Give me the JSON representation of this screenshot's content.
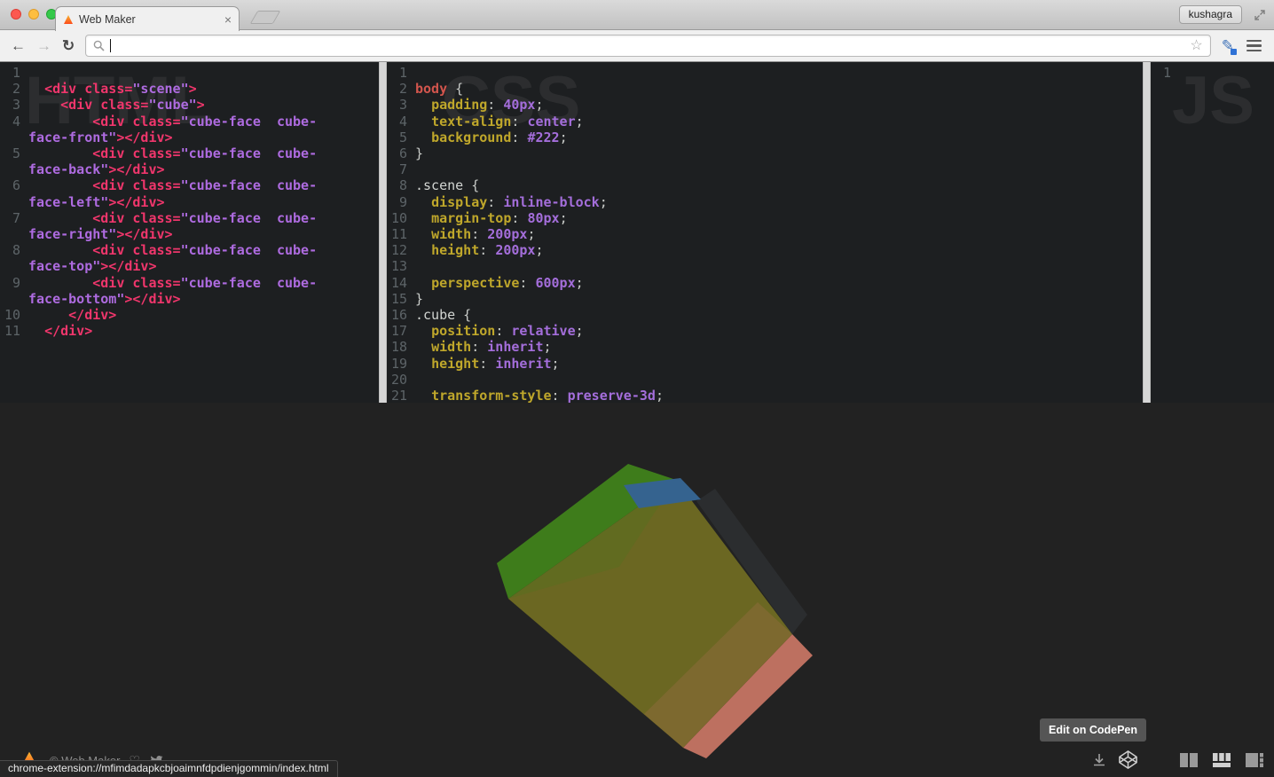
{
  "window": {
    "tab_title": "Web Maker",
    "close_tab": "×",
    "profile_name": "kushagra"
  },
  "toolbar": {
    "back": "←",
    "forward": "→",
    "reload": "↻",
    "url_value": "",
    "bookmark_star": "☆",
    "extension_pencil": "✎"
  },
  "editors": {
    "html": {
      "label": "HTML",
      "lines": [
        {
          "n": 1,
          "s": []
        },
        {
          "n": 2,
          "s": [
            [
              "pln",
              "  "
            ],
            [
              "tag",
              "<div "
            ],
            [
              "attr",
              "class="
            ],
            [
              "str",
              "\"scene\""
            ],
            [
              "tag",
              ">"
            ]
          ]
        },
        {
          "n": 3,
          "s": [
            [
              "pln",
              "    "
            ],
            [
              "tag",
              "<div "
            ],
            [
              "attr",
              "class="
            ],
            [
              "str",
              "\"cube\""
            ],
            [
              "tag",
              ">"
            ]
          ]
        },
        {
          "n": 4,
          "s": [
            [
              "pln",
              "        "
            ],
            [
              "tag",
              "<div "
            ],
            [
              "attr",
              "class="
            ],
            [
              "str",
              "\"cube-face  cube-face-front\""
            ],
            [
              "tag",
              "></div>"
            ]
          ]
        },
        {
          "n": 5,
          "s": [
            [
              "pln",
              "        "
            ],
            [
              "tag",
              "<div "
            ],
            [
              "attr",
              "class="
            ],
            [
              "str",
              "\"cube-face  cube-face-back\""
            ],
            [
              "tag",
              "></div>"
            ]
          ]
        },
        {
          "n": 6,
          "s": [
            [
              "pln",
              "        "
            ],
            [
              "tag",
              "<div "
            ],
            [
              "attr",
              "class="
            ],
            [
              "str",
              "\"cube-face  cube-face-left\""
            ],
            [
              "tag",
              "></div>"
            ]
          ]
        },
        {
          "n": 7,
          "s": [
            [
              "pln",
              "        "
            ],
            [
              "tag",
              "<div "
            ],
            [
              "attr",
              "class="
            ],
            [
              "str",
              "\"cube-face  cube-face-right\""
            ],
            [
              "tag",
              "></div>"
            ]
          ]
        },
        {
          "n": 8,
          "s": [
            [
              "pln",
              "        "
            ],
            [
              "tag",
              "<div "
            ],
            [
              "attr",
              "class="
            ],
            [
              "str",
              "\"cube-face  cube-face-top\""
            ],
            [
              "tag",
              "></div>"
            ]
          ]
        },
        {
          "n": 9,
          "s": [
            [
              "pln",
              "        "
            ],
            [
              "tag",
              "<div "
            ],
            [
              "attr",
              "class="
            ],
            [
              "str",
              "\"cube-face  cube-face-bottom\""
            ],
            [
              "tag",
              "></div>"
            ]
          ]
        },
        {
          "n": 10,
          "s": [
            [
              "pln",
              "     "
            ],
            [
              "tag",
              "</div>"
            ]
          ]
        },
        {
          "n": 11,
          "s": [
            [
              "pln",
              "  "
            ],
            [
              "tag",
              "</div>"
            ]
          ]
        }
      ]
    },
    "css": {
      "label": "CSS",
      "lines": [
        {
          "n": 1,
          "s": []
        },
        {
          "n": 2,
          "s": [
            [
              "ored",
              "body"
            ],
            [
              "pun",
              " {"
            ]
          ]
        },
        {
          "n": 3,
          "s": [
            [
              "pln",
              "  "
            ],
            [
              "prop",
              "padding"
            ],
            [
              "pun",
              ": "
            ],
            [
              "val",
              "40px"
            ],
            [
              "pun",
              ";"
            ]
          ]
        },
        {
          "n": 4,
          "s": [
            [
              "pln",
              "  "
            ],
            [
              "prop",
              "text-align"
            ],
            [
              "pun",
              ": "
            ],
            [
              "val",
              "center"
            ],
            [
              "pun",
              ";"
            ]
          ]
        },
        {
          "n": 5,
          "s": [
            [
              "pln",
              "  "
            ],
            [
              "prop",
              "background"
            ],
            [
              "pun",
              ": "
            ],
            [
              "val",
              "#222"
            ],
            [
              "pun",
              ";"
            ]
          ]
        },
        {
          "n": 6,
          "s": [
            [
              "pun",
              "}"
            ]
          ]
        },
        {
          "n": 7,
          "s": []
        },
        {
          "n": 8,
          "s": [
            [
              "csel",
              ".scene"
            ],
            [
              "pun",
              " {"
            ]
          ]
        },
        {
          "n": 9,
          "s": [
            [
              "pln",
              "  "
            ],
            [
              "prop",
              "display"
            ],
            [
              "pun",
              ": "
            ],
            [
              "val",
              "inline-block"
            ],
            [
              "pun",
              ";"
            ]
          ]
        },
        {
          "n": 10,
          "s": [
            [
              "pln",
              "  "
            ],
            [
              "prop",
              "margin-top"
            ],
            [
              "pun",
              ": "
            ],
            [
              "val",
              "80px"
            ],
            [
              "pun",
              ";"
            ]
          ]
        },
        {
          "n": 11,
          "s": [
            [
              "pln",
              "  "
            ],
            [
              "prop",
              "width"
            ],
            [
              "pun",
              ": "
            ],
            [
              "val",
              "200px"
            ],
            [
              "pun",
              ";"
            ]
          ]
        },
        {
          "n": 12,
          "s": [
            [
              "pln",
              "  "
            ],
            [
              "prop",
              "height"
            ],
            [
              "pun",
              ": "
            ],
            [
              "val",
              "200px"
            ],
            [
              "pun",
              ";"
            ]
          ]
        },
        {
          "n": 13,
          "s": []
        },
        {
          "n": 14,
          "s": [
            [
              "pln",
              "  "
            ],
            [
              "prop",
              "perspective"
            ],
            [
              "pun",
              ": "
            ],
            [
              "val",
              "600px"
            ],
            [
              "pun",
              ";"
            ]
          ]
        },
        {
          "n": 15,
          "s": [
            [
              "pun",
              "}"
            ]
          ]
        },
        {
          "n": 16,
          "s": [
            [
              "csel",
              ".cube"
            ],
            [
              "pun",
              " {"
            ]
          ]
        },
        {
          "n": 17,
          "s": [
            [
              "pln",
              "  "
            ],
            [
              "prop",
              "position"
            ],
            [
              "pun",
              ": "
            ],
            [
              "val",
              "relative"
            ],
            [
              "pun",
              ";"
            ]
          ]
        },
        {
          "n": 18,
          "s": [
            [
              "pln",
              "  "
            ],
            [
              "prop",
              "width"
            ],
            [
              "pun",
              ": "
            ],
            [
              "val",
              "inherit"
            ],
            [
              "pun",
              ";"
            ]
          ]
        },
        {
          "n": 19,
          "s": [
            [
              "pln",
              "  "
            ],
            [
              "prop",
              "height"
            ],
            [
              "pun",
              ": "
            ],
            [
              "val",
              "inherit"
            ],
            [
              "pun",
              ";"
            ]
          ]
        },
        {
          "n": 20,
          "s": []
        },
        {
          "n": 21,
          "s": [
            [
              "pln",
              "  "
            ],
            [
              "prop",
              "transform-style"
            ],
            [
              "pun",
              ": "
            ],
            [
              "val",
              "preserve-3d"
            ],
            [
              "pun",
              ";"
            ]
          ]
        }
      ]
    },
    "js": {
      "label": "JS",
      "lines": [
        {
          "n": 1,
          "s": []
        }
      ]
    }
  },
  "preview": {
    "cube": {
      "front": "#6b6722",
      "left": "#3e7c1b",
      "bottom": "#bd7060",
      "top": "#35638f",
      "right": "#2b2d2f"
    },
    "background": "#222222"
  },
  "footer": {
    "copyright": "© Web Maker",
    "heart": "♡",
    "codepen_tooltip": "Edit on CodePen",
    "status_url": "chrome-extension://mfimdadapkcbjoaimnfdpdienjgommin/index.html"
  },
  "colors": {
    "editor_bg": "#1d1f21",
    "tag_red": "#f0366c",
    "string_purple": "#ae6be0",
    "property_yellow": "#bfa72b",
    "value_purple": "#a46edb"
  }
}
